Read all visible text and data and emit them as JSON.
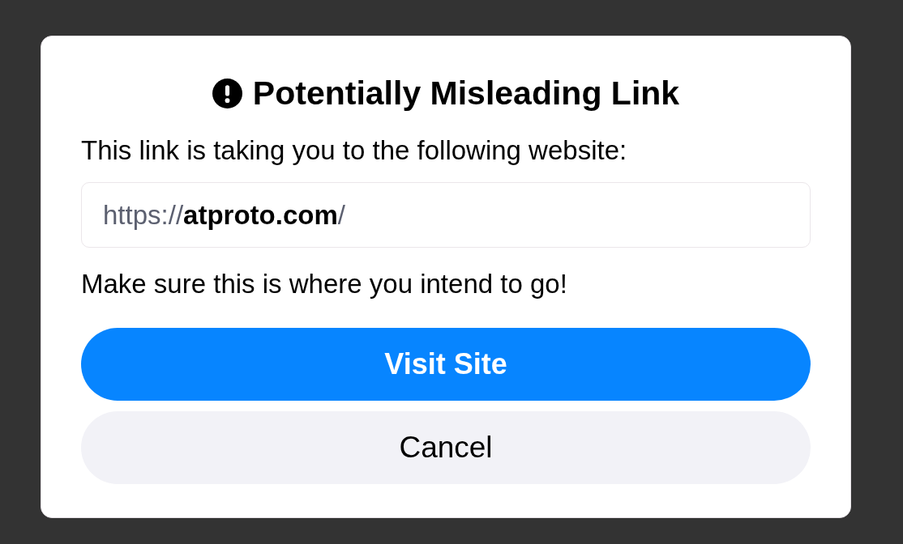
{
  "dialog": {
    "title": "Potentially Misleading Link",
    "description": "This link is taking you to the following website:",
    "url": "https://**atproto.com**/",
    "warning": "Make sure this is where you intend to go!",
    "buttons": [
      {
        "label": "Visit Site",
        "kind": "primary"
      },
      {
        "label": "Cancel",
        "kind": "secondary"
      }
    ]
  }
}
